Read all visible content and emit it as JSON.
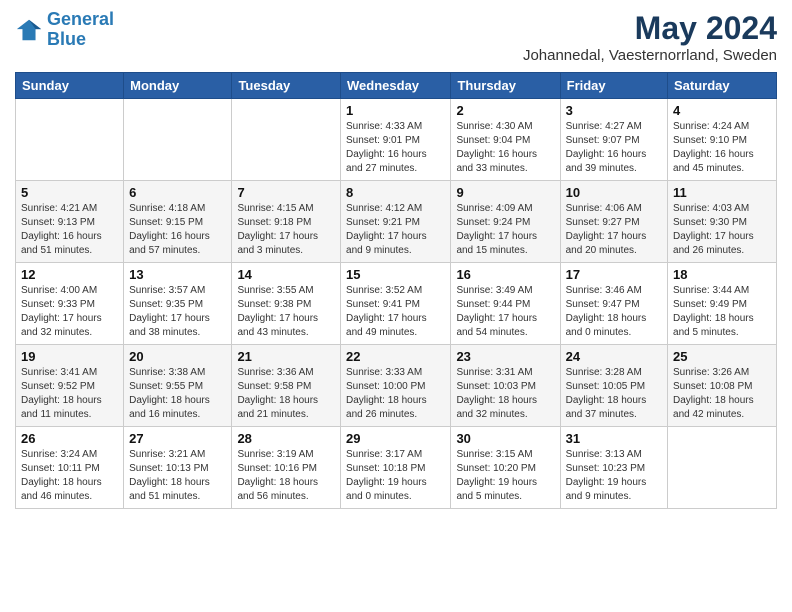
{
  "header": {
    "logo_line1": "General",
    "logo_line2": "Blue",
    "month": "May 2024",
    "location": "Johannedal, Vaesternorrland, Sweden"
  },
  "weekdays": [
    "Sunday",
    "Monday",
    "Tuesday",
    "Wednesday",
    "Thursday",
    "Friday",
    "Saturday"
  ],
  "weeks": [
    [
      {
        "day": "",
        "info": ""
      },
      {
        "day": "",
        "info": ""
      },
      {
        "day": "",
        "info": ""
      },
      {
        "day": "1",
        "info": "Sunrise: 4:33 AM\nSunset: 9:01 PM\nDaylight: 16 hours\nand 27 minutes."
      },
      {
        "day": "2",
        "info": "Sunrise: 4:30 AM\nSunset: 9:04 PM\nDaylight: 16 hours\nand 33 minutes."
      },
      {
        "day": "3",
        "info": "Sunrise: 4:27 AM\nSunset: 9:07 PM\nDaylight: 16 hours\nand 39 minutes."
      },
      {
        "day": "4",
        "info": "Sunrise: 4:24 AM\nSunset: 9:10 PM\nDaylight: 16 hours\nand 45 minutes."
      }
    ],
    [
      {
        "day": "5",
        "info": "Sunrise: 4:21 AM\nSunset: 9:13 PM\nDaylight: 16 hours\nand 51 minutes."
      },
      {
        "day": "6",
        "info": "Sunrise: 4:18 AM\nSunset: 9:15 PM\nDaylight: 16 hours\nand 57 minutes."
      },
      {
        "day": "7",
        "info": "Sunrise: 4:15 AM\nSunset: 9:18 PM\nDaylight: 17 hours\nand 3 minutes."
      },
      {
        "day": "8",
        "info": "Sunrise: 4:12 AM\nSunset: 9:21 PM\nDaylight: 17 hours\nand 9 minutes."
      },
      {
        "day": "9",
        "info": "Sunrise: 4:09 AM\nSunset: 9:24 PM\nDaylight: 17 hours\nand 15 minutes."
      },
      {
        "day": "10",
        "info": "Sunrise: 4:06 AM\nSunset: 9:27 PM\nDaylight: 17 hours\nand 20 minutes."
      },
      {
        "day": "11",
        "info": "Sunrise: 4:03 AM\nSunset: 9:30 PM\nDaylight: 17 hours\nand 26 minutes."
      }
    ],
    [
      {
        "day": "12",
        "info": "Sunrise: 4:00 AM\nSunset: 9:33 PM\nDaylight: 17 hours\nand 32 minutes."
      },
      {
        "day": "13",
        "info": "Sunrise: 3:57 AM\nSunset: 9:35 PM\nDaylight: 17 hours\nand 38 minutes."
      },
      {
        "day": "14",
        "info": "Sunrise: 3:55 AM\nSunset: 9:38 PM\nDaylight: 17 hours\nand 43 minutes."
      },
      {
        "day": "15",
        "info": "Sunrise: 3:52 AM\nSunset: 9:41 PM\nDaylight: 17 hours\nand 49 minutes."
      },
      {
        "day": "16",
        "info": "Sunrise: 3:49 AM\nSunset: 9:44 PM\nDaylight: 17 hours\nand 54 minutes."
      },
      {
        "day": "17",
        "info": "Sunrise: 3:46 AM\nSunset: 9:47 PM\nDaylight: 18 hours\nand 0 minutes."
      },
      {
        "day": "18",
        "info": "Sunrise: 3:44 AM\nSunset: 9:49 PM\nDaylight: 18 hours\nand 5 minutes."
      }
    ],
    [
      {
        "day": "19",
        "info": "Sunrise: 3:41 AM\nSunset: 9:52 PM\nDaylight: 18 hours\nand 11 minutes."
      },
      {
        "day": "20",
        "info": "Sunrise: 3:38 AM\nSunset: 9:55 PM\nDaylight: 18 hours\nand 16 minutes."
      },
      {
        "day": "21",
        "info": "Sunrise: 3:36 AM\nSunset: 9:58 PM\nDaylight: 18 hours\nand 21 minutes."
      },
      {
        "day": "22",
        "info": "Sunrise: 3:33 AM\nSunset: 10:00 PM\nDaylight: 18 hours\nand 26 minutes."
      },
      {
        "day": "23",
        "info": "Sunrise: 3:31 AM\nSunset: 10:03 PM\nDaylight: 18 hours\nand 32 minutes."
      },
      {
        "day": "24",
        "info": "Sunrise: 3:28 AM\nSunset: 10:05 PM\nDaylight: 18 hours\nand 37 minutes."
      },
      {
        "day": "25",
        "info": "Sunrise: 3:26 AM\nSunset: 10:08 PM\nDaylight: 18 hours\nand 42 minutes."
      }
    ],
    [
      {
        "day": "26",
        "info": "Sunrise: 3:24 AM\nSunset: 10:11 PM\nDaylight: 18 hours\nand 46 minutes."
      },
      {
        "day": "27",
        "info": "Sunrise: 3:21 AM\nSunset: 10:13 PM\nDaylight: 18 hours\nand 51 minutes."
      },
      {
        "day": "28",
        "info": "Sunrise: 3:19 AM\nSunset: 10:16 PM\nDaylight: 18 hours\nand 56 minutes."
      },
      {
        "day": "29",
        "info": "Sunrise: 3:17 AM\nSunset: 10:18 PM\nDaylight: 19 hours\nand 0 minutes."
      },
      {
        "day": "30",
        "info": "Sunrise: 3:15 AM\nSunset: 10:20 PM\nDaylight: 19 hours\nand 5 minutes."
      },
      {
        "day": "31",
        "info": "Sunrise: 3:13 AM\nSunset: 10:23 PM\nDaylight: 19 hours\nand 9 minutes."
      },
      {
        "day": "",
        "info": ""
      }
    ]
  ]
}
